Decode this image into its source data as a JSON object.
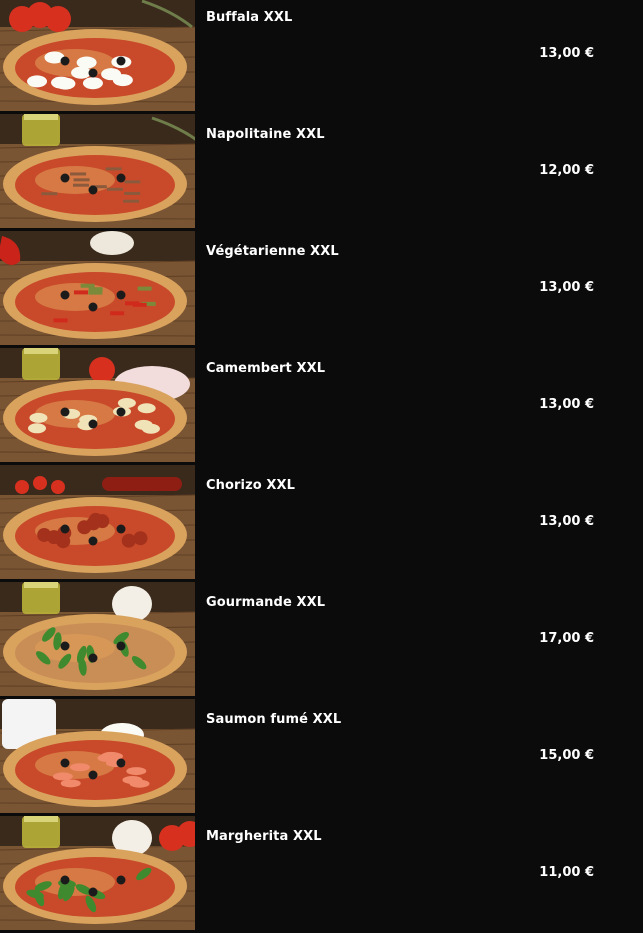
{
  "menu": {
    "items": [
      {
        "name": "Buffala XXL",
        "price": "13,00 €",
        "image": "pizza-buffala-image",
        "topping": "mozzarella",
        "props": [
          "tomatoes",
          "herb"
        ]
      },
      {
        "name": "Napolitaine XXL",
        "price": "12,00 €",
        "image": "pizza-napolitaine-image",
        "topping": "anchovy",
        "props": [
          "oil-bottle",
          "olive-branch"
        ]
      },
      {
        "name": "Végétarienne XXL",
        "price": "13,00 €",
        "image": "pizza-vegetarienne-image",
        "topping": "peppers",
        "props": [
          "red-pepper",
          "mushroom"
        ]
      },
      {
        "name": "Camembert XXL",
        "price": "13,00 €",
        "image": "pizza-camembert-image",
        "topping": "camembert",
        "props": [
          "oil-bottle",
          "tomato",
          "camembert-box"
        ]
      },
      {
        "name": "Chorizo XXL",
        "price": "13,00 €",
        "image": "pizza-chorizo-image",
        "topping": "chorizo",
        "props": [
          "cherry-tomatoes",
          "chorizo-sausage"
        ]
      },
      {
        "name": "Gourmande XXL",
        "price": "17,00 €",
        "image": "pizza-gourmande-image",
        "topping": "arugula",
        "props": [
          "oil-bottle",
          "garlic"
        ]
      },
      {
        "name": "Saumon fumé XXL",
        "price": "15,00 €",
        "image": "pizza-saumon-fume-image",
        "topping": "salmon",
        "props": [
          "jug",
          "mozzarella"
        ]
      },
      {
        "name": "Margherita XXL",
        "price": "11,00 €",
        "image": "pizza-margherita-image",
        "topping": "basil",
        "props": [
          "oil-bottle",
          "garlic",
          "tomatoes"
        ]
      }
    ]
  },
  "colors": {
    "background": "#0b0b0b",
    "text": "#ffffff",
    "crust": "#d9a35e",
    "sauce": "#c94a2a",
    "wood": "#7a5533"
  }
}
